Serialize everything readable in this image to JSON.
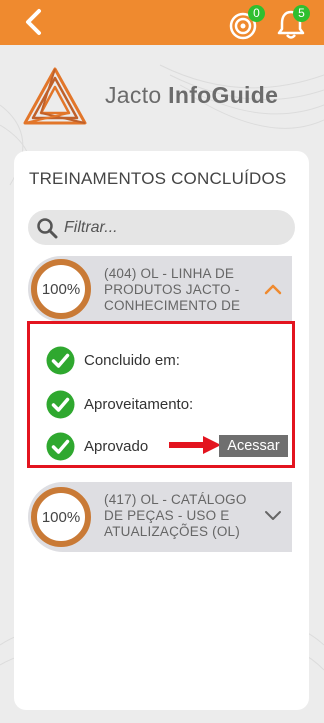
{
  "header": {
    "back_icon": "chevron-left-icon",
    "coins_icon": "target-coin-icon",
    "coins_badge": "0",
    "notifications_icon": "bell-icon",
    "notifications_badge": "5",
    "bar_color": "#ef8a2f",
    "badge_color": "#2fbf2f"
  },
  "brand": {
    "logo_icon": "jacto-triangle-logo",
    "name_regular": "Jacto ",
    "name_bold": "InfoGuide"
  },
  "section": {
    "title": "TREINAMENTOS CONCLUÍDOS"
  },
  "filter": {
    "placeholder": "Filtrar...",
    "value": "",
    "icon": "search-icon"
  },
  "courses": [
    {
      "progress": "100%",
      "title": "(404) OL - LINHA DE PRODUTOS JACTO - CONHECIMENTO DE",
      "expanded": true,
      "details": [
        {
          "label": "Concluido em:"
        },
        {
          "label": "Aproveitamento:"
        },
        {
          "label": "Aprovado"
        }
      ],
      "action_label": "Acessar"
    },
    {
      "progress": "100%",
      "title": "(417) OL - CATÁLOGO DE PEÇAS - USO E ATUALIZAÇÕES (OL)",
      "expanded": false
    }
  ],
  "colors": {
    "accent": "#ef8a2f",
    "ring": "#c97a36",
    "check": "#2fa82f",
    "highlight": "#e3141f",
    "button": "#6f6f6f"
  }
}
